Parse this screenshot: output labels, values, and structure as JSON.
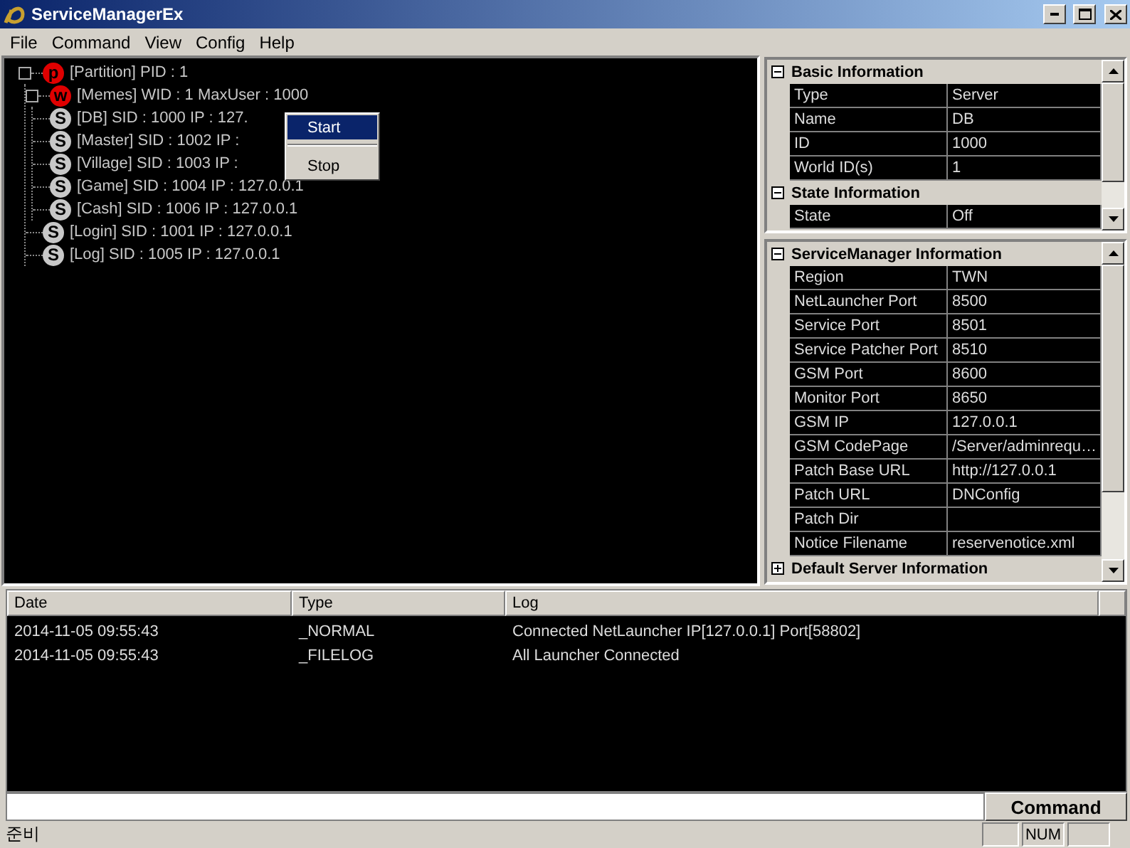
{
  "window": {
    "title": "ServiceManagerEx"
  },
  "menu": [
    "File",
    "Command",
    "View",
    "Config",
    "Help"
  ],
  "tree": [
    {
      "kind": "partition",
      "badge": "p",
      "label": "[Partition] PID : 1",
      "children": [
        {
          "kind": "world",
          "badge": "w",
          "label": "[Memes] WID : 1 MaxUser : 1000",
          "children": [
            {
              "kind": "server",
              "badge": "S",
              "label": "[DB] SID : 1000 IP : 127."
            },
            {
              "kind": "server",
              "badge": "S",
              "label": "[Master] SID : 1002 IP :"
            },
            {
              "kind": "server",
              "badge": "S",
              "label": "[Village] SID : 1003 IP :"
            },
            {
              "kind": "server",
              "badge": "S",
              "label": "[Game] SID : 1004 IP : 127.0.0.1"
            },
            {
              "kind": "server",
              "badge": "S",
              "label": "[Cash] SID : 1006 IP : 127.0.0.1"
            }
          ]
        },
        {
          "kind": "server",
          "badge": "S",
          "label": "[Login] SID : 1001 IP : 127.0.0.1"
        },
        {
          "kind": "server",
          "badge": "S",
          "label": "[Log] SID : 1005 IP : 127.0.0.1"
        }
      ]
    }
  ],
  "context_menu": [
    {
      "label": "Start",
      "selected": true
    },
    {
      "label": "Stop",
      "selected": false
    }
  ],
  "property_grids": [
    {
      "sections": [
        {
          "title": "Basic Information",
          "expanded": true,
          "rows": [
            {
              "name": "Type",
              "value": "Server"
            },
            {
              "name": "Name",
              "value": "DB"
            },
            {
              "name": "ID",
              "value": "1000"
            },
            {
              "name": "World ID(s)",
              "value": "1"
            }
          ]
        },
        {
          "title": "State Information",
          "expanded": true,
          "rows": [
            {
              "name": "State",
              "value": "Off"
            }
          ]
        }
      ]
    },
    {
      "sections": [
        {
          "title": "ServiceManager Information",
          "expanded": true,
          "rows": [
            {
              "name": "Region",
              "value": "TWN"
            },
            {
              "name": "NetLauncher Port",
              "value": "8500"
            },
            {
              "name": "Service Port",
              "value": "8501"
            },
            {
              "name": "Service Patcher Port",
              "value": "8510"
            },
            {
              "name": "GSM Port",
              "value": "8600"
            },
            {
              "name": "Monitor Port",
              "value": "8650"
            },
            {
              "name": "GSM IP",
              "value": "127.0.0.1"
            },
            {
              "name": "GSM CodePage",
              "value": "/Server/adminrequ…"
            },
            {
              "name": "Patch Base URL",
              "value": "http://127.0.0.1"
            },
            {
              "name": "Patch URL",
              "value": "DNConfig"
            },
            {
              "name": "Patch Dir"
            },
            {
              "name": "Notice Filename",
              "value": "reservenotice.xml"
            }
          ]
        },
        {
          "title": "Default Server Information",
          "expanded": false
        }
      ]
    }
  ],
  "log": {
    "columns": [
      "Date",
      "Type",
      "Log"
    ],
    "rows": [
      [
        "2014-11-05 09:55:43",
        "_NORMAL",
        "Connected NetLauncher IP[127.0.0.1] Port[58802]"
      ],
      [
        "2014-11-05 09:55:43",
        "_FILELOG",
        "All Launcher Connected"
      ]
    ]
  },
  "command_button": "Command",
  "status_bar": {
    "text": "준비",
    "num_indicator": "NUM"
  }
}
